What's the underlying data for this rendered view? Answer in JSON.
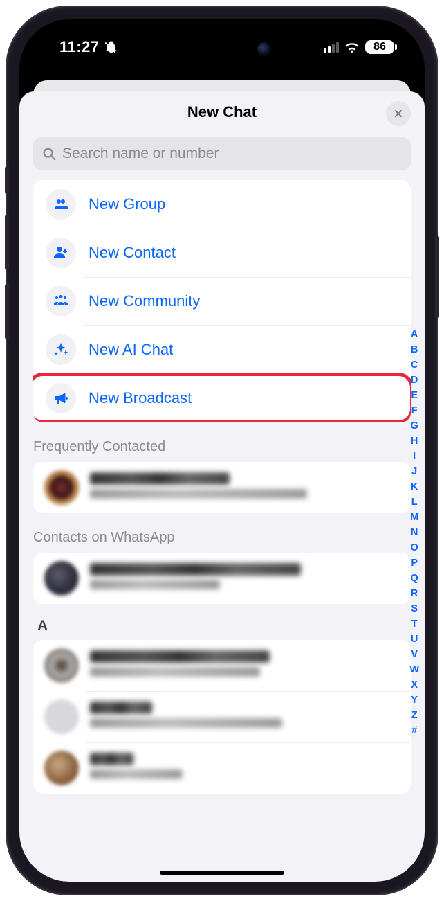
{
  "statusbar": {
    "time": "11:27",
    "battery": "86"
  },
  "sheet": {
    "title": "New Chat"
  },
  "search": {
    "placeholder": "Search name or number"
  },
  "options": [
    {
      "label": "New Group",
      "icon": "group-icon"
    },
    {
      "label": "New Contact",
      "icon": "add-contact-icon"
    },
    {
      "label": "New Community",
      "icon": "community-icon"
    },
    {
      "label": "New AI Chat",
      "icon": "sparkle-icon"
    },
    {
      "label": "New Broadcast",
      "icon": "megaphone-icon"
    }
  ],
  "sections": {
    "frequent": "Frequently Contacted",
    "contacts_on": "Contacts on WhatsApp",
    "letter_a": "A"
  },
  "alpha_index": [
    "A",
    "B",
    "C",
    "D",
    "E",
    "F",
    "G",
    "H",
    "I",
    "J",
    "K",
    "L",
    "M",
    "N",
    "O",
    "P",
    "Q",
    "R",
    "S",
    "T",
    "U",
    "V",
    "W",
    "X",
    "Y",
    "Z",
    "#"
  ]
}
